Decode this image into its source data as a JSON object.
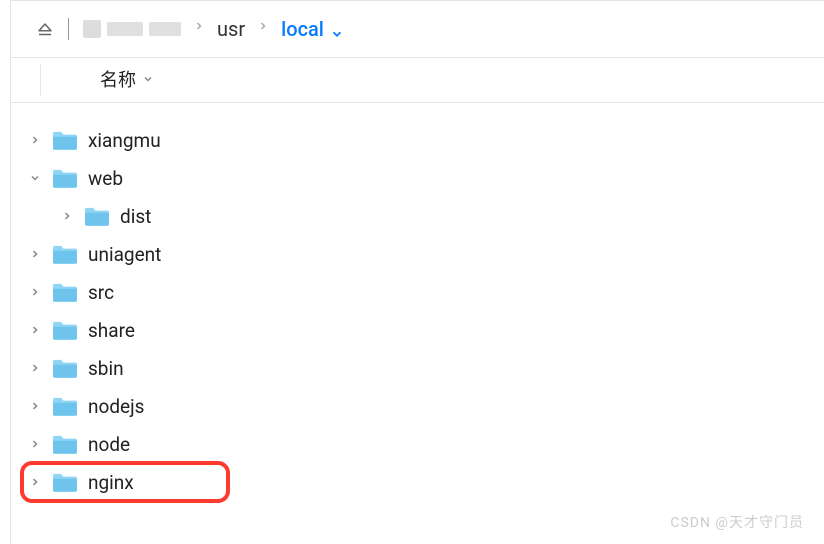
{
  "breadcrumb": {
    "segments": [
      "usr",
      "local"
    ],
    "active_index": 1
  },
  "columns": {
    "name_header": "名称"
  },
  "tree": [
    {
      "name": "xiangmu",
      "expanded": false,
      "level": 0,
      "highlighted": false
    },
    {
      "name": "web",
      "expanded": true,
      "level": 0,
      "highlighted": false
    },
    {
      "name": "dist",
      "expanded": false,
      "level": 1,
      "highlighted": false
    },
    {
      "name": "uniagent",
      "expanded": false,
      "level": 0,
      "highlighted": false
    },
    {
      "name": "src",
      "expanded": false,
      "level": 0,
      "highlighted": false
    },
    {
      "name": "share",
      "expanded": false,
      "level": 0,
      "highlighted": false
    },
    {
      "name": "sbin",
      "expanded": false,
      "level": 0,
      "highlighted": false
    },
    {
      "name": "nodejs",
      "expanded": false,
      "level": 0,
      "highlighted": false
    },
    {
      "name": "node",
      "expanded": false,
      "level": 0,
      "highlighted": false
    },
    {
      "name": "nginx",
      "expanded": false,
      "level": 0,
      "highlighted": true
    }
  ],
  "watermark": "CSDN @天才守门员",
  "colors": {
    "folder_light": "#8fd5f5",
    "folder_dark": "#6ec4ed",
    "accent": "#0a7aff",
    "highlight": "#ff3b30"
  }
}
